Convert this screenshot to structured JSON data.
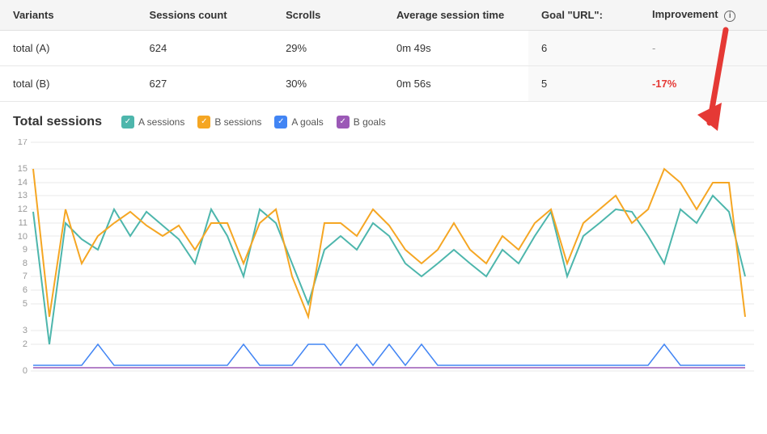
{
  "table": {
    "headers": {
      "variants": "Variants",
      "sessions_count": "Sessions count",
      "scrolls": "Scrolls",
      "avg_session_time": "Average session time",
      "goal_url": "Goal \"URL\":",
      "improvement": "Improvement"
    },
    "rows": [
      {
        "variant": "total (A)",
        "sessions": "624",
        "scrolls": "29%",
        "avg_time": "0m 49s",
        "goal": "6",
        "improvement": "-",
        "improvement_type": "dash"
      },
      {
        "variant": "total (B)",
        "sessions": "627",
        "scrolls": "30%",
        "avg_time": "0m 56s",
        "goal": "5",
        "improvement": "-17%",
        "improvement_type": "negative"
      }
    ]
  },
  "chart": {
    "title": "Total sessions",
    "legend": [
      {
        "label": "A sessions",
        "color": "#4db6ac",
        "type": "check"
      },
      {
        "label": "B sessions",
        "color": "#f5a623",
        "type": "check"
      },
      {
        "label": "A goals",
        "color": "#4285f4",
        "type": "check"
      },
      {
        "label": "B goals",
        "color": "#9b59b6",
        "type": "check"
      }
    ],
    "y_axis": [
      0,
      2,
      3,
      5,
      6,
      7,
      8,
      9,
      10,
      11,
      12,
      13,
      14,
      15,
      17
    ],
    "info_label": "i"
  }
}
